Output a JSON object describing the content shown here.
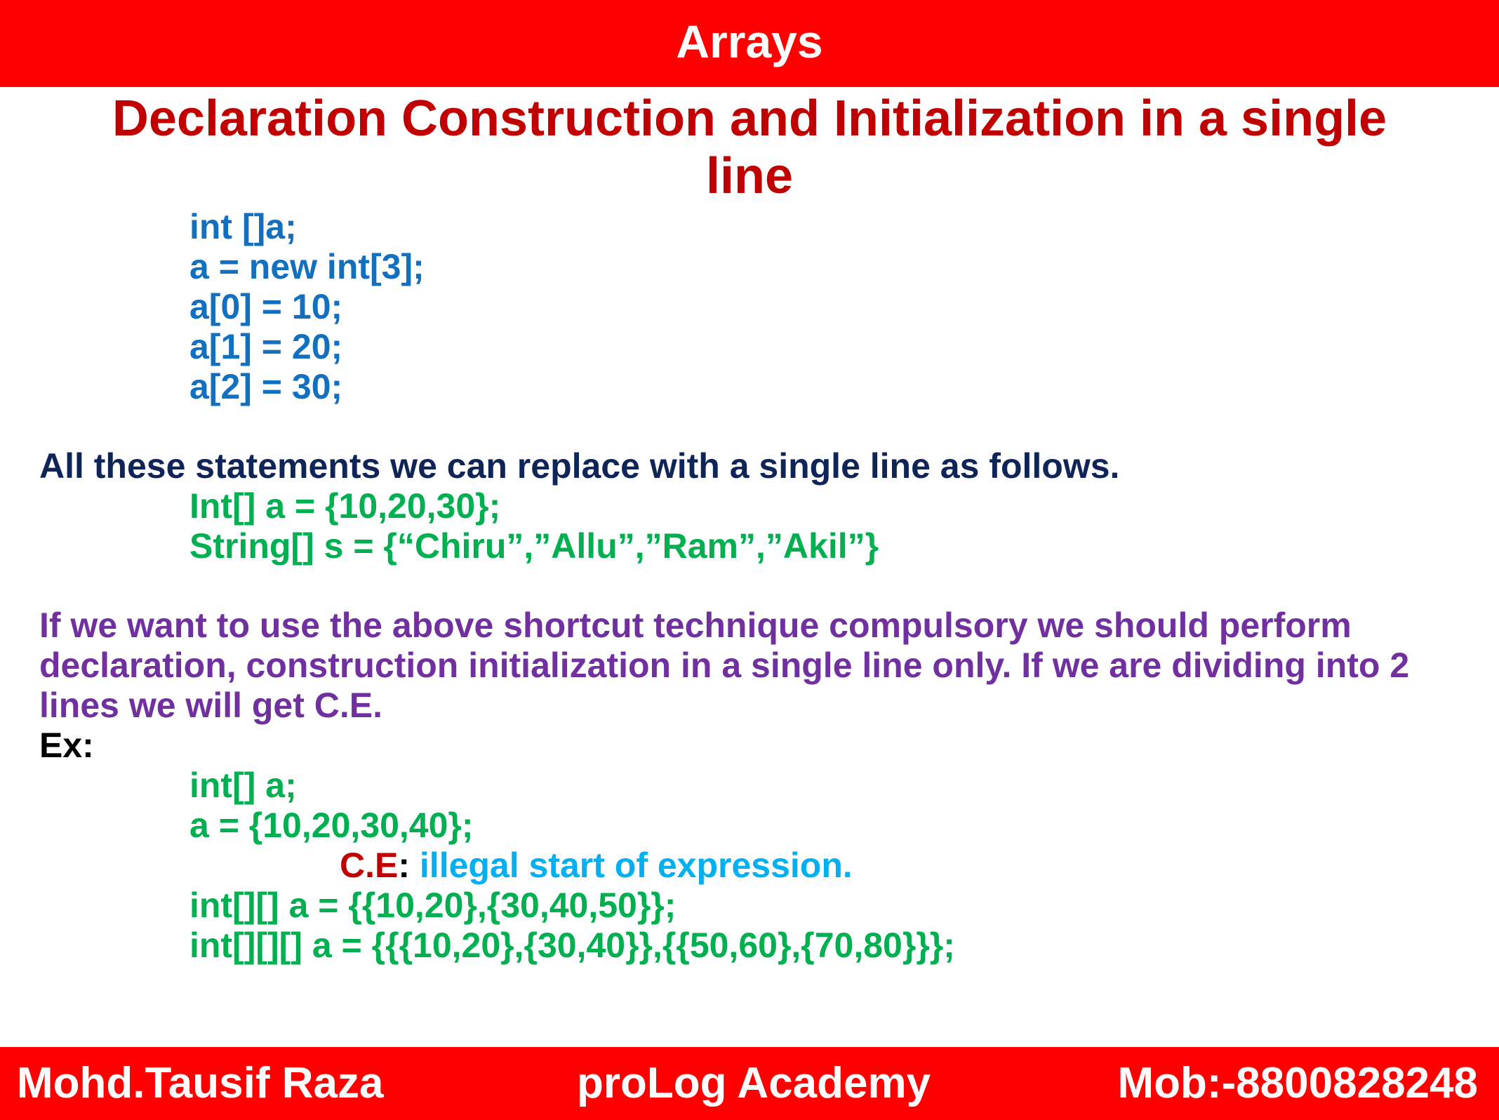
{
  "header": {
    "title": "Arrays"
  },
  "subtitle": {
    "line1": "Declaration Construction and Initialization in a single",
    "line2": "line"
  },
  "code_block_1": [
    "int []a;",
    "a = new int[3];",
    "a[0] = 10;",
    "a[1] = 20;",
    "a[2] = 30;"
  ],
  "statement": "All these statements we can replace with a single line as follows.",
  "code_block_2": [
    "Int[] a = {10,20,30};",
    "String[] s = {“Chiru”,”Allu”,”Ram”,”Akil”}"
  ],
  "note": [
    "If we want to use the above shortcut technique compulsory we should perform",
    "declaration, construction initialization in a single line only. If we are dividing into 2",
    "lines we will get C.E."
  ],
  "example_label": "Ex:",
  "code_block_3": [
    "int[] a;",
    "a = {10,20,30,40};"
  ],
  "error": {
    "prefix": "C.E",
    "colon": ":",
    "message": " illegal start of expression."
  },
  "code_block_4": [
    "int[][] a = {{10,20},{30,40,50}};",
    "int[][][] a = {{{10,20},{30,40}},{{50,60},{70,80}}};"
  ],
  "footer": {
    "author": "Mohd.Tausif Raza",
    "academy": "proLog Academy",
    "mobile": "Mob:-8800828248"
  },
  "colors": {
    "bar_red": "#ff0000",
    "title_darkred": "#c00000",
    "code_blue": "#1270be",
    "code_green": "#00b050",
    "navy_text": "#0f2557",
    "purple_text": "#7030a0",
    "error_cyan": "#00b0f0"
  }
}
